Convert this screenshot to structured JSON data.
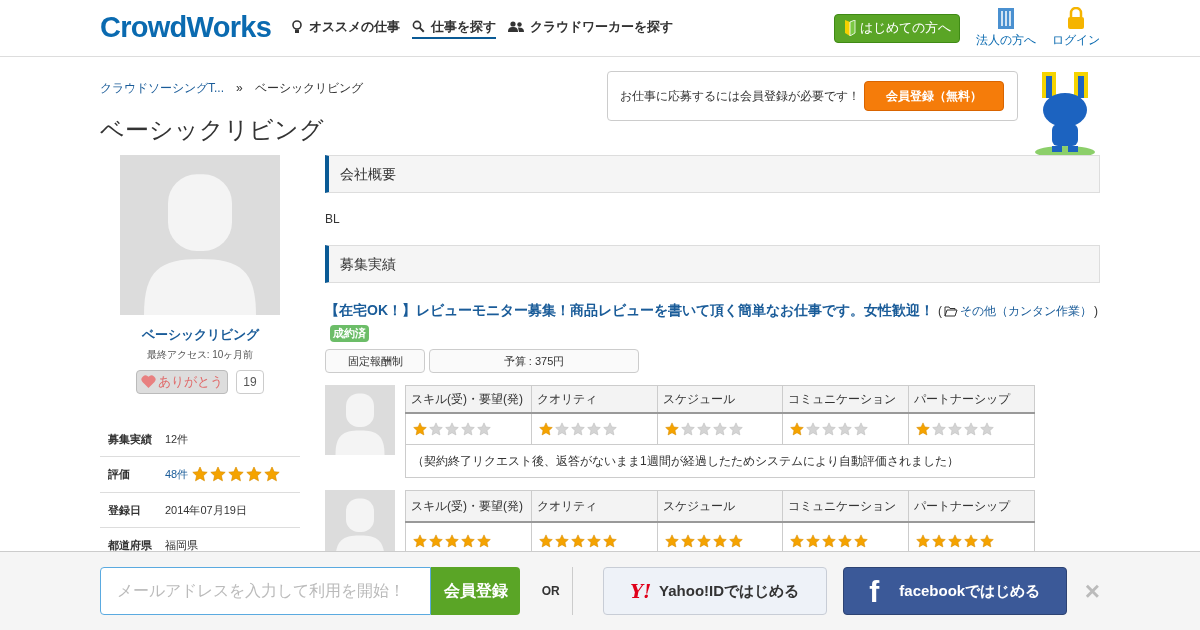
{
  "header": {
    "logo": "CrowdWorks",
    "nav": [
      {
        "label": "オススメの仕事",
        "kind": "bulb",
        "selected": false
      },
      {
        "label": "仕事を探す",
        "kind": "search",
        "selected": true
      },
      {
        "label": "クラウドワーカーを探す",
        "kind": "people",
        "selected": false
      }
    ],
    "beginner_button": "はじめての方へ",
    "links": [
      {
        "label": "法人の方へ",
        "kind": "building"
      },
      {
        "label": "ログイン",
        "kind": "lock"
      }
    ]
  },
  "breadcrumb": [
    "クラウドソーシングT...",
    "ベーシックリビング"
  ],
  "breadcrumb_separator": "»",
  "page_title": "ベーシックリビング",
  "signup_prompt": {
    "text": "お仕事に応募するには会員登録が必要です！",
    "button": "会員登録（無料）"
  },
  "profile": {
    "name": "ベーシックリビング",
    "last_access": "最終アクセス: 10ヶ月前",
    "thanks_button": "ありがとう",
    "thanks_count": "19",
    "stats": [
      {
        "label": "募集実績",
        "value": "12件"
      },
      {
        "label": "評価",
        "value": "48件",
        "stars": 5
      },
      {
        "label": "登録日",
        "value": "2014年07月19日"
      },
      {
        "label": "都道府県",
        "value": "福岡県"
      }
    ]
  },
  "sections": [
    {
      "title": "会社概要",
      "body": "BL"
    },
    {
      "title": "募集実績"
    }
  ],
  "job": {
    "title": "【在宅OK！】レビューモニター募集！商品レビューを書いて頂く簡単なお仕事です。女性歓迎！",
    "category_open": "(",
    "category": "その他（カンタン作業）",
    "category_close": ")",
    "status": "成約済",
    "pay_type": "固定報酬制",
    "budget": "予算 : 375円"
  },
  "reviews": [
    {
      "columns": [
        {
          "label": "スキル(受)・要望(発)",
          "stars": 1
        },
        {
          "label": "クオリティ",
          "stars": 1
        },
        {
          "label": "スケジュール",
          "stars": 1
        },
        {
          "label": "コミュニケーション",
          "stars": 1
        },
        {
          "label": "パートナーシップ",
          "stars": 1
        }
      ],
      "comment": "（契約終了リクエスト後、返答がないまま1週間が経過したためシステムにより自動評価されました）"
    },
    {
      "columns": [
        {
          "label": "スキル(受)・要望(発)",
          "stars": 5
        },
        {
          "label": "クオリティ",
          "stars": 5
        },
        {
          "label": "スケジュール",
          "stars": 5
        },
        {
          "label": "コミュニケーション",
          "stars": 5
        },
        {
          "label": "パートナーシップ",
          "stars": 5
        }
      ]
    }
  ],
  "bottom_bar": {
    "email_placeholder": "メールアドレスを入力して利用を開始！",
    "register_button": "会員登録",
    "or": "OR",
    "yahoo_logo": "Y!",
    "yahoo_button": "Yahoo!IDではじめる",
    "facebook_logo": "f",
    "facebook_button": "facebookではじめる",
    "close": "×"
  }
}
